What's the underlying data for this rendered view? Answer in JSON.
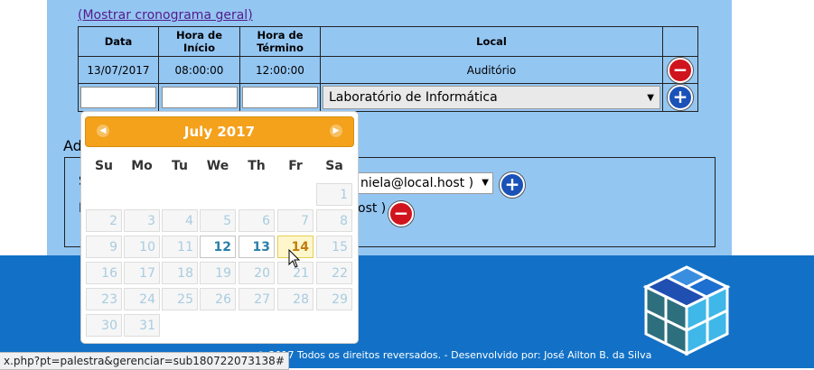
{
  "schedule": {
    "show_link": "(Mostrar cronograma geral)",
    "headers": [
      "Data",
      "Hora de Início",
      "Hora de Término",
      "Local"
    ],
    "row": {
      "date": "13/07/2017",
      "start": "08:00:00",
      "end": "12:00:00",
      "local": "Auditório"
    },
    "new_row": {
      "date": "",
      "start": "",
      "end": "",
      "local_selected": "Laboratório de Informática"
    }
  },
  "section": {
    "label_clipped": "Ad",
    "line1_clipped": "S",
    "line2_clipped": "I",
    "user_select_value": "niela@local.host )",
    "user_remove_text": "ost )"
  },
  "calendar": {
    "month_label": "July 2017",
    "weekdays": [
      "Su",
      "Mo",
      "Tu",
      "We",
      "Th",
      "Fr",
      "Sa"
    ],
    "selectable_days": [
      12,
      13,
      14
    ],
    "highlighted_day": 14
  },
  "footer": {
    "copyright": "© 2017 Todos os direitos reversados. - Desenvolvido por: José Ailton B. da Silva"
  },
  "status_bar": {
    "url": "x.php?pt=palestra&gerenciar=sub180722073138#"
  },
  "colors": {
    "content_bg": "#94c6f2",
    "footer_bg": "#1271c6",
    "calendar_header": "#f4a11b",
    "remove_button": "#d0141d",
    "add_button": "#1a52b8"
  }
}
